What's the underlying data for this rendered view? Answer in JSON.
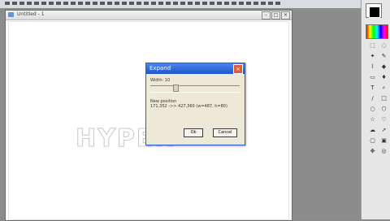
{
  "document": {
    "title": "Untitled - 1",
    "canvas_text": "HYPER"
  },
  "dialog": {
    "title": "Expand",
    "width_label": "Width: 10",
    "slider_value": 0.25,
    "position_title": "New position",
    "position_value": "171,352 ->> 427,360 (w=487, h=80)",
    "ok_label": "Ok",
    "cancel_label": "Cancel"
  },
  "tools": [
    "select-icon",
    "lasso-icon",
    "wand-icon",
    "pencil-icon",
    "brush-icon",
    "fill-icon",
    "eraser-icon",
    "eyedropper-icon",
    "text-icon",
    "zoom-icon",
    "line-icon",
    "rect-icon",
    "ellipse-icon",
    "shape-icon",
    "star-icon",
    "heart-icon",
    "cloud-icon",
    "arrow-icon",
    "callout-icon",
    "frame-icon",
    "pan-icon",
    "dropper-icon"
  ]
}
